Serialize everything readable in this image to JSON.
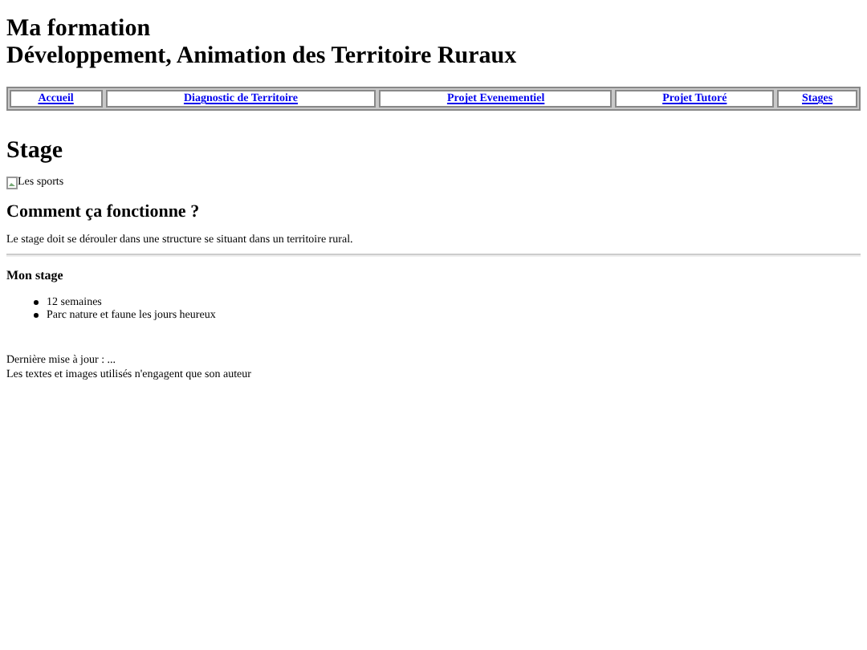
{
  "header": {
    "lines": [
      "Ma formation",
      "Développement, Animation des Territoire Ruraux"
    ]
  },
  "nav": [
    {
      "label": "Accueil"
    },
    {
      "label": "Diagnostic de Territoire"
    },
    {
      "label": "Projet Evenementiel"
    },
    {
      "label": "Projet Tutoré"
    },
    {
      "label": "Stages"
    }
  ],
  "page_title": "Stage",
  "image": {
    "alt": "Les sports"
  },
  "section": {
    "title": "Comment ça fonctionne ?",
    "text": "Le stage doit se dérouler dans une structure se situant dans un territoire rural."
  },
  "stage": {
    "title": "Mon stage",
    "items": [
      "12 semaines",
      "Parc nature et faune les jours heureux"
    ]
  },
  "footer": [
    "Dernière mise à jour : ...",
    "Les textes et images utilisés n'engagent que son auteur"
  ]
}
